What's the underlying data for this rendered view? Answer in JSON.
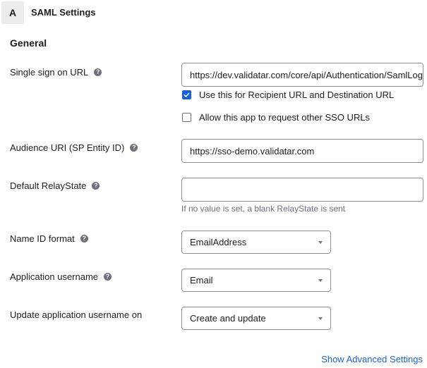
{
  "section": {
    "badge": "A",
    "title": "SAML Settings"
  },
  "general": {
    "title": "General"
  },
  "fields": {
    "sso_url": {
      "label": "Single sign on URL",
      "value": "https://dev.validatar.com/core/api/Authentication/SamlLogin"
    },
    "recipient_checkbox": {
      "label": "Use this for Recipient URL and Destination URL",
      "checked": true
    },
    "other_sso_checkbox": {
      "label": "Allow this app to request other SSO URLs",
      "checked": false
    },
    "audience_uri": {
      "label": "Audience URI (SP Entity ID)",
      "value": "https://sso-demo.validatar.com"
    },
    "relay_state": {
      "label": "Default RelayState",
      "value": "",
      "hint": "If no value is set, a blank RelayState is sent"
    },
    "name_id_format": {
      "label": "Name ID format",
      "value": "EmailAddress"
    },
    "app_username": {
      "label": "Application username",
      "value": "Email"
    },
    "update_username_on": {
      "label": "Update application username on",
      "value": "Create and update"
    }
  },
  "links": {
    "advanced": "Show Advanced Settings"
  },
  "icons": {
    "help": "?"
  },
  "colors": {
    "accent": "#1662dd",
    "help_icon": "#6e6e78",
    "hint_text": "#6e6e78"
  }
}
